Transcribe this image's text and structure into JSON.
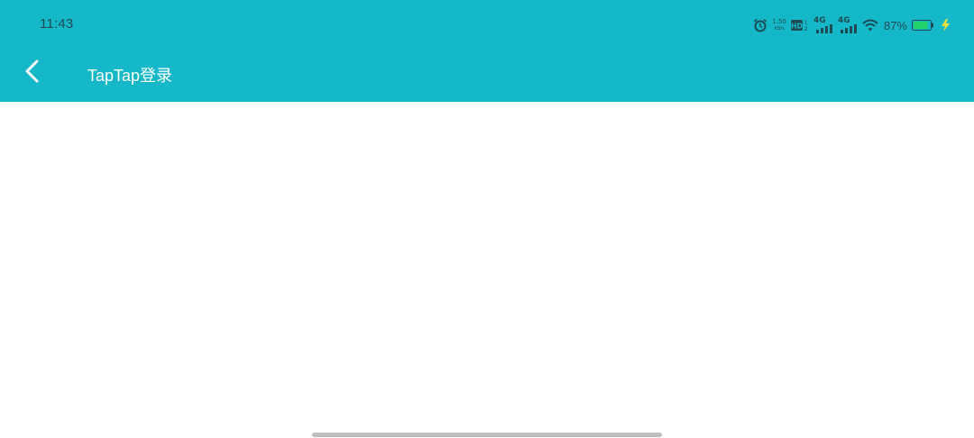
{
  "status_bar": {
    "time": "11:43",
    "net_speed_value": "1.50",
    "net_speed_unit": "KB/s",
    "hd_label": "HD",
    "sim1_label": "4G",
    "sim2_label": "4G",
    "battery_percent": "87%",
    "battery_level": 0.87,
    "icons": [
      "alarm-icon",
      "hd-icon",
      "signal-4g-icon",
      "signal-4g-icon",
      "wifi-icon",
      "battery-icon",
      "charging-icon"
    ]
  },
  "app_bar": {
    "back_icon": "chevron-left-icon",
    "title": "TapTap登录"
  },
  "colors": {
    "header_bg": "#15b8c8",
    "title_text": "#ffffff",
    "status_text": "#1b4b52",
    "battery_fill": "#22d16b",
    "charging_bolt": "#e8e23a",
    "page_bg": "#ffffff",
    "home_indicator": "#bdbdbd"
  }
}
